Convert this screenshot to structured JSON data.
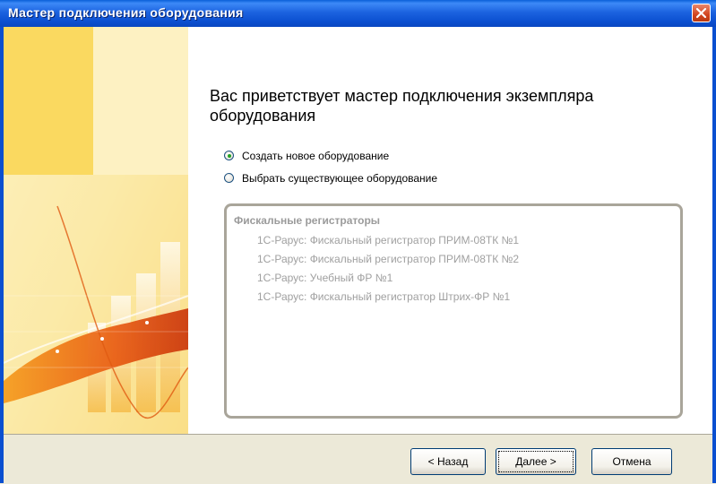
{
  "window": {
    "title": "Мастер подключения оборудования"
  },
  "heading": "Вас приветствует мастер подключения экземпляра оборудования",
  "options": [
    {
      "label": "Создать новое оборудование",
      "selected": true
    },
    {
      "label": "Выбрать существующее оборудование",
      "selected": false
    }
  ],
  "equipment_list": {
    "group_label": "Фискальные регистраторы",
    "items": [
      "1С-Рарус: Фискальный регистратор ПРИМ-08ТК №1",
      "1С-Рарус: Фискальный регистратор ПРИМ-08ТК №2",
      "1С-Рарус: Учебный ФР №1",
      "1С-Рарус: Фискальный регистратор Штрих-ФР №1"
    ]
  },
  "buttons": {
    "back": "< Назад",
    "next": "Далее >",
    "cancel": "Отмена"
  },
  "colors": {
    "titlebar": "#0a5fd8",
    "close": "#d2451f",
    "dialog_bg": "#ece9d8"
  },
  "icons": {
    "close": "close-icon",
    "banner": "chart-illustration"
  }
}
